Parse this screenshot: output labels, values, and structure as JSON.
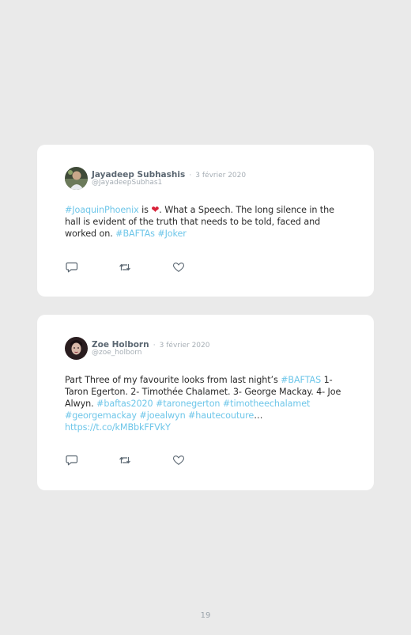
{
  "tweets": [
    {
      "author": "Jayadeep Subhashis",
      "separator": "·",
      "date": "3 février 2020",
      "handle": "@JayadeepSubhas1",
      "text": {
        "hashtag_joaquin": "#JoaquinPhoenix",
        "is": " is ",
        "emoji": "❤",
        "body": ". What a Speech. The long silence in the hall is evident of the truth that needs to be told, faced and worked on. ",
        "hashtag_baftas": "#BAFTAs",
        "space": " ",
        "hashtag_joker": "#Joker"
      }
    },
    {
      "author": "Zoe Holborn",
      "separator": "·",
      "date": "3 février 2020",
      "handle": "@zoe_holborn",
      "text": {
        "body1": "Part Three of my favourite looks from last night’s ",
        "hashtag_baftas": "#BAFTAS",
        "body2": " 1- Taron Egerton. 2- Timothée Chalamet. 3- George Mackay. 4- Joe Alwyn. ",
        "hashtag_baftas2020": "#baftas2020",
        "s1": " ",
        "hashtag_taronegerton": "#taronegerton",
        "s2": " ",
        "hashtag_timotheechalamet": "#timotheechalamet",
        "s3": " ",
        "hashtag_georgemackay": "#georgemackay",
        "s4": " ",
        "hashtag_joealwyn": "#joealwyn",
        "s5": " ",
        "hashtag_hautecouture": "#hautecouture",
        "ellipsis": "… ",
        "link": "https://t.co/kMBbkFFVkY"
      }
    }
  ],
  "icons": {
    "reply": "reply-icon",
    "retweet": "retweet-icon",
    "like": "heart-icon"
  },
  "colors": {
    "background": "#eaeaea",
    "card": "#ffffff",
    "link": "#6ec6e9",
    "name": "#5b6772",
    "muted": "#a6aeb5",
    "emoji": "#d9233a"
  },
  "page_number": "19"
}
